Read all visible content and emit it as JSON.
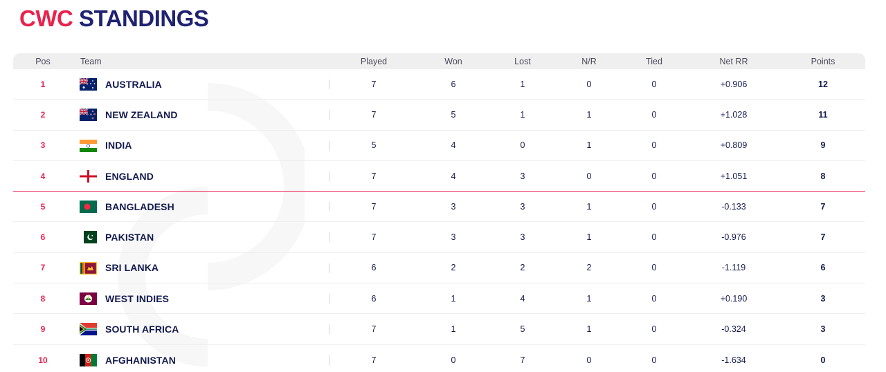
{
  "title": {
    "part1": "CWC",
    "part2": "STANDINGS"
  },
  "headers": {
    "pos": "Pos",
    "team": "Team",
    "played": "Played",
    "won": "Won",
    "lost": "Lost",
    "nr": "N/R",
    "tied": "Tied",
    "nrr": "Net RR",
    "points": "Points"
  },
  "rows": [
    {
      "pos": "1",
      "team": "AUSTRALIA",
      "flag": "australia-flag-icon",
      "played": "7",
      "won": "6",
      "lost": "1",
      "nr": "0",
      "tied": "0",
      "nrr": "+0.906",
      "points": "12"
    },
    {
      "pos": "2",
      "team": "NEW ZEALAND",
      "flag": "new-zealand-flag-icon",
      "played": "7",
      "won": "5",
      "lost": "1",
      "nr": "1",
      "tied": "0",
      "nrr": "+1.028",
      "points": "11"
    },
    {
      "pos": "3",
      "team": "INDIA",
      "flag": "india-flag-icon",
      "played": "5",
      "won": "4",
      "lost": "0",
      "nr": "1",
      "tied": "0",
      "nrr": "+0.809",
      "points": "9"
    },
    {
      "pos": "4",
      "team": "ENGLAND",
      "flag": "england-flag-icon",
      "played": "7",
      "won": "4",
      "lost": "3",
      "nr": "0",
      "tied": "0",
      "nrr": "+1.051",
      "points": "8"
    },
    {
      "pos": "5",
      "team": "BANGLADESH",
      "flag": "bangladesh-flag-icon",
      "played": "7",
      "won": "3",
      "lost": "3",
      "nr": "1",
      "tied": "0",
      "nrr": "-0.133",
      "points": "7"
    },
    {
      "pos": "6",
      "team": "PAKISTAN",
      "flag": "pakistan-flag-icon",
      "played": "7",
      "won": "3",
      "lost": "3",
      "nr": "1",
      "tied": "0",
      "nrr": "-0.976",
      "points": "7"
    },
    {
      "pos": "7",
      "team": "SRI LANKA",
      "flag": "sri-lanka-flag-icon",
      "played": "6",
      "won": "2",
      "lost": "2",
      "nr": "2",
      "tied": "0",
      "nrr": "-1.119",
      "points": "6"
    },
    {
      "pos": "8",
      "team": "WEST INDIES",
      "flag": "west-indies-flag-icon",
      "played": "6",
      "won": "1",
      "lost": "4",
      "nr": "1",
      "tied": "0",
      "nrr": "+0.190",
      "points": "3"
    },
    {
      "pos": "9",
      "team": "SOUTH AFRICA",
      "flag": "south-africa-flag-icon",
      "played": "7",
      "won": "1",
      "lost": "5",
      "nr": "1",
      "tied": "0",
      "nrr": "-0.324",
      "points": "3"
    },
    {
      "pos": "10",
      "team": "AFGHANISTAN",
      "flag": "afghanistan-flag-icon",
      "played": "7",
      "won": "0",
      "lost": "7",
      "nr": "0",
      "tied": "0",
      "nrr": "-1.634",
      "points": "0"
    }
  ],
  "colors": {
    "accent": "#e8224d",
    "navy": "#1f2272",
    "text": "#131a4e",
    "header_bg": "#efefef"
  }
}
